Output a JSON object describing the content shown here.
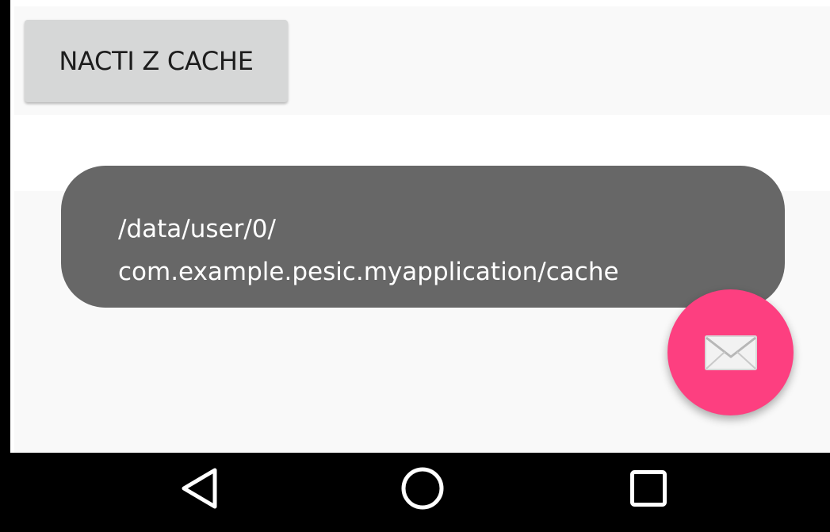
{
  "main": {
    "cache_button_label": "NACTI Z CACHE"
  },
  "toast": {
    "line1": "/data/user/0/",
    "line2": "com.example.pesic.myapplication/cache"
  },
  "fab": {
    "icon": "email-icon",
    "color": "#fd3f80"
  },
  "navigation": {
    "back_icon": "back-triangle-icon",
    "home_icon": "home-circle-icon",
    "recents_icon": "recents-square-icon"
  },
  "colors": {
    "app_background": "#f9f9f9",
    "button_background": "#d6d7d7",
    "toast_background": "#676767",
    "navigation_bar": "#000000"
  }
}
